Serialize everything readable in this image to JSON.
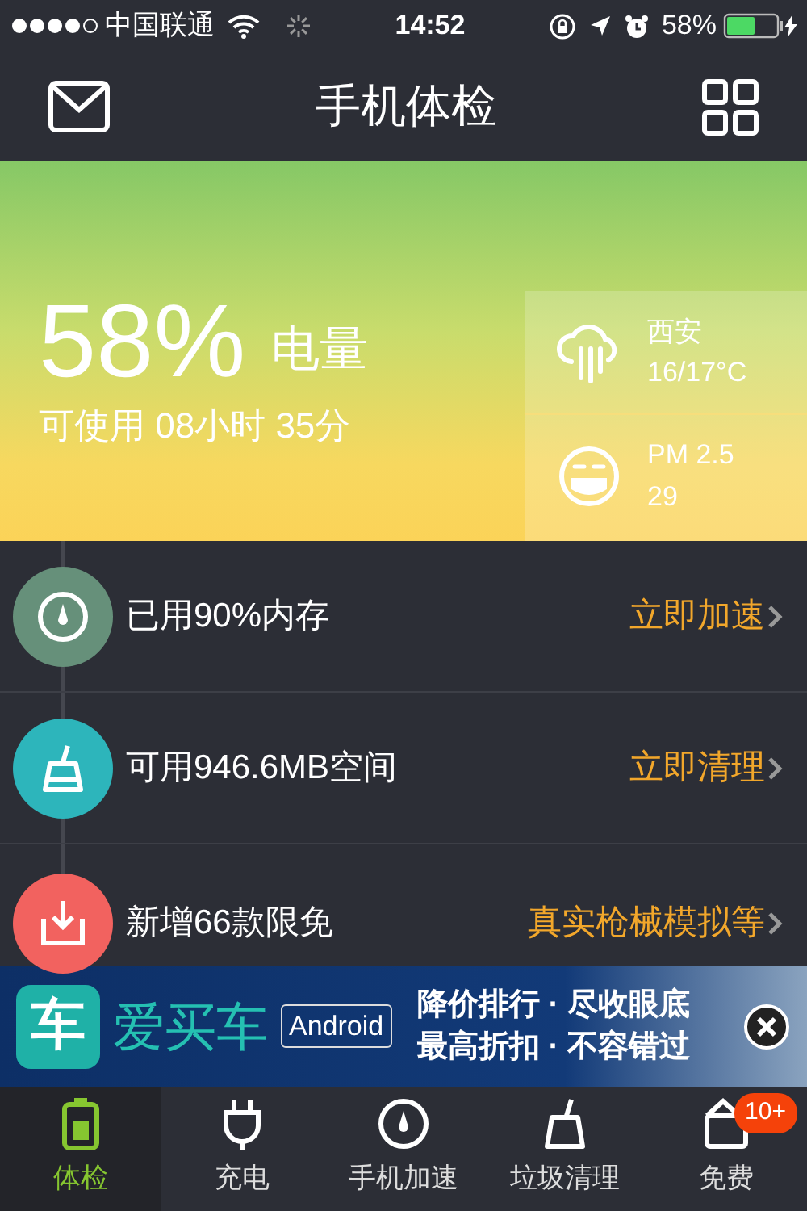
{
  "status_bar": {
    "carrier": "中国联通",
    "time": "14:52",
    "battery_text": "58%"
  },
  "header": {
    "title": "手机体检"
  },
  "battery": {
    "percent": "58%",
    "label": "电量",
    "remaining": "可使用 08小时 35分"
  },
  "info": [
    {
      "kind": "weather",
      "line1": "西安",
      "line2": "16/17°C"
    },
    {
      "kind": "air",
      "line1": "PM 2.5",
      "line2": "29"
    }
  ],
  "items": [
    {
      "kind": "memory",
      "color": "#66907a",
      "text": "已用90%内存",
      "action": "立即加速"
    },
    {
      "kind": "clean",
      "color": "#2db5bb",
      "text": "可用946.6MB空间",
      "action": "立即清理"
    },
    {
      "kind": "apps",
      "color": "#f2625f",
      "text": "新增66款限免",
      "action": "真实枪械模拟等"
    }
  ],
  "ad": {
    "logo": "车",
    "app_name": "爱买车",
    "platform": "Android",
    "lines": [
      "降价排行 · 尽收眼底",
      "最高折扣 · 不容错过"
    ]
  },
  "tabs": [
    {
      "kind": "check",
      "label": "体检",
      "selected": true
    },
    {
      "kind": "charge",
      "label": "充电",
      "selected": false
    },
    {
      "kind": "speed",
      "label": "手机加速",
      "selected": false
    },
    {
      "kind": "clean",
      "label": "垃圾清理",
      "selected": false
    },
    {
      "kind": "free",
      "label": "免费",
      "selected": false,
      "badge": "10+"
    }
  ]
}
